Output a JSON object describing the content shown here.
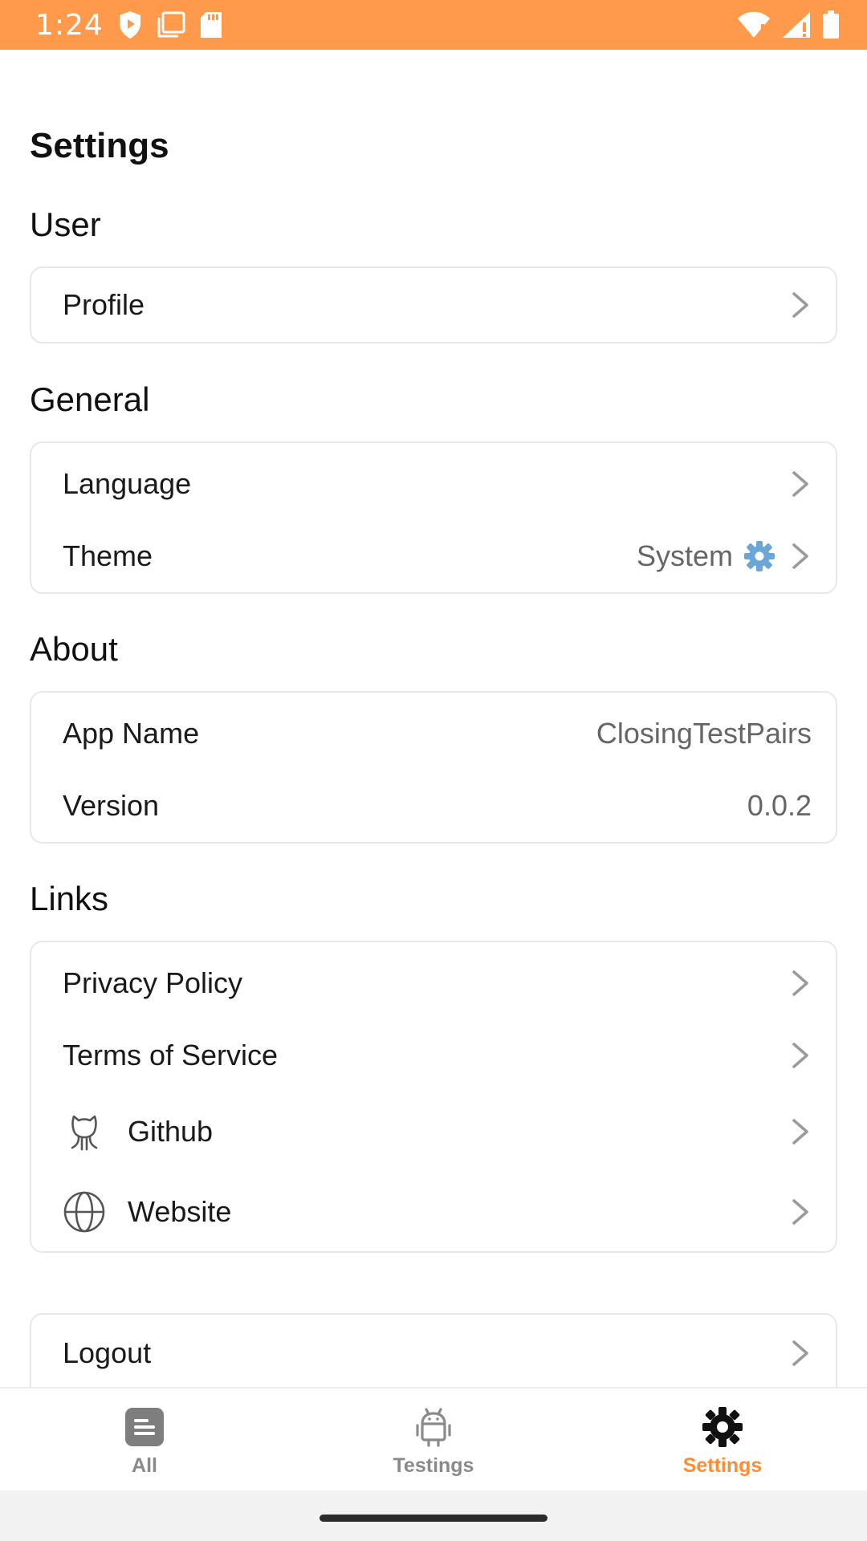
{
  "status_bar": {
    "time": "1:24"
  },
  "page": {
    "title": "Settings"
  },
  "sections": {
    "user": {
      "label": "User",
      "profile": "Profile"
    },
    "general": {
      "label": "General",
      "language": "Language",
      "theme": "Theme",
      "theme_value": "System"
    },
    "about": {
      "label": "About",
      "app_name": "App Name",
      "app_name_value": "ClosingTestPairs",
      "version": "Version",
      "version_value": "0.0.2"
    },
    "links": {
      "label": "Links",
      "privacy": "Privacy Policy",
      "terms": "Terms of Service",
      "github": "Github",
      "website": "Website"
    },
    "logout": "Logout"
  },
  "bottom_nav": [
    {
      "label": "All",
      "icon": "list-icon",
      "active": false
    },
    {
      "label": "Testings",
      "icon": "android-icon",
      "active": false
    },
    {
      "label": "Settings",
      "icon": "gear-icon",
      "active": true
    }
  ],
  "colors": {
    "accent": "#ff8c33",
    "status_bar": "#ff9a4d",
    "muted": "#666666"
  }
}
